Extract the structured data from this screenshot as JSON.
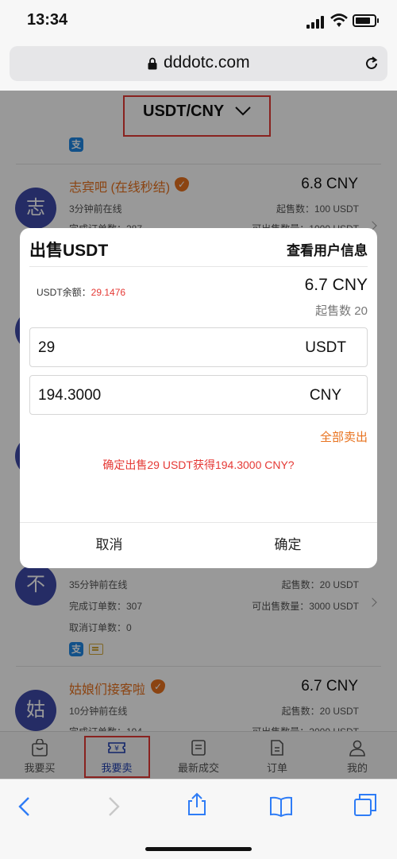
{
  "status_bar": {
    "time": "13:34"
  },
  "browser": {
    "url": "dddotc.com"
  },
  "pair_selector": {
    "label": "USDT/CNY"
  },
  "pay_method_icon": "支",
  "sellers": [
    {
      "avatar": "志",
      "name": "志宾吧 (在线秒结)",
      "price": "6.8 CNY",
      "online": "3分钟前在线",
      "min_label": "起售数：100 USDT",
      "completed": "完成订单数：287",
      "available": "可出售数量：1000 USDT"
    },
    {
      "avatar": "不",
      "online": "35分钟前在线",
      "min_label": "起售数：20 USDT",
      "completed": "完成订单数：307",
      "available": "可出售数量：3000 USDT",
      "canceled": "取消订单数：0"
    },
    {
      "avatar": "姑",
      "name": "姑娘们接客啦",
      "price": "6.7 CNY",
      "online": "10分钟前在线",
      "min_label": "起售数：20 USDT",
      "completed": "完成订单数：194",
      "available": "可出售数量：2000 USDT"
    }
  ],
  "tabs": [
    {
      "label": "我要买"
    },
    {
      "label": "我要卖"
    },
    {
      "label": "最新成交"
    },
    {
      "label": "订单"
    },
    {
      "label": "我的"
    }
  ],
  "dialog": {
    "title": "出售USDT",
    "view_user": "查看用户信息",
    "balance_label": "USDT余额：",
    "balance_value": "29.1476",
    "price": "6.7 CNY",
    "min_sell": "起售数 20",
    "amount_value": "29",
    "amount_unit": "USDT",
    "total_value": "194.3000",
    "total_unit": "CNY",
    "sell_all": "全部卖出",
    "confirm_message": "确定出售29 USDT获得194.3000 CNY?",
    "cancel": "取消",
    "confirm": "确定"
  },
  "colors": {
    "accent_orange": "#e8721e",
    "alert_red": "#e53935",
    "brand_blue": "#1f3fb0",
    "avatar_blue": "#3f4aa8"
  }
}
